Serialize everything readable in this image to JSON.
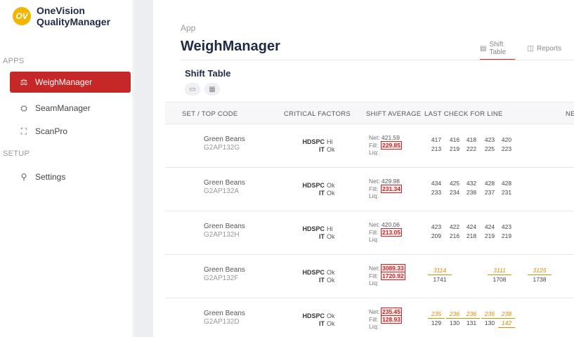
{
  "app": {
    "logo_mark": "OV",
    "logo_line1": "OneVision",
    "logo_line2": "QualityManager"
  },
  "sidebar": {
    "apps_label": "APPS",
    "setup_label": "SETUP",
    "items": [
      {
        "label": "WeighManager",
        "icon": "scale-icon",
        "glyph": "⚖",
        "active": true
      },
      {
        "label": "SeamManager",
        "icon": "seam-icon",
        "glyph": "⛭",
        "active": false
      },
      {
        "label": "ScanPro",
        "icon": "scan-icon",
        "glyph": "⛶",
        "active": false
      },
      {
        "label": "Settings",
        "icon": "user-settings-icon",
        "glyph": "⚲",
        "active": false
      }
    ]
  },
  "header": {
    "crumb": "App",
    "title": "WeighManager",
    "tabs": [
      {
        "label": "Shift Table",
        "glyph": "▤",
        "active": true
      },
      {
        "label": "Reports",
        "glyph": "◫",
        "active": false
      }
    ]
  },
  "section": {
    "title": "Shift Table",
    "tool_glyphs": [
      "▭",
      "▦"
    ]
  },
  "table": {
    "columns": [
      "SET / TOP CODE",
      "CRITICAL FACTORS",
      "SHIFT AVERAGE",
      "LAST CHECK FOR LINE",
      "NEXT"
    ],
    "avg_labels": {
      "net": "Net:",
      "fill": "Fill:",
      "liq": "Liq:"
    },
    "crit_labels": {
      "a": "HDSPC",
      "b": "IT"
    },
    "rows": [
      {
        "name": "Green Beans",
        "code": "G2AP132G",
        "hdspc": "Hi",
        "it": "Ok",
        "net": "421.59",
        "net_alert": false,
        "fill": "229.85",
        "fill_alert": true,
        "checks_top": [
          "417",
          "416",
          "418",
          "423",
          "420"
        ],
        "checks_bottom": [
          "213",
          "219",
          "222",
          "225",
          "223"
        ],
        "warn": false
      },
      {
        "name": "Green Beans",
        "code": "G2AP132A",
        "hdspc": "Ok",
        "it": "Ok",
        "net": "429.98",
        "net_alert": false,
        "fill": "231.34",
        "fill_alert": true,
        "checks_top": [
          "434",
          "425",
          "432",
          "428",
          "428"
        ],
        "checks_bottom": [
          "233",
          "234",
          "238",
          "237",
          "231"
        ],
        "warn": false
      },
      {
        "name": "Green Beans",
        "code": "G2AP132H",
        "hdspc": "Hi",
        "it": "Ok",
        "net": "420.06",
        "net_alert": false,
        "fill": "213.05",
        "fill_alert": true,
        "checks_top": [
          "423",
          "422",
          "424",
          "424",
          "423"
        ],
        "checks_bottom": [
          "209",
          "216",
          "218",
          "219",
          "219"
        ],
        "warn": false
      },
      {
        "name": "Green Beans",
        "code": "G2AP132F",
        "hdspc": "Ok",
        "it": "Ok",
        "net": "3089.33",
        "net_alert": true,
        "fill": "1720.92",
        "fill_alert": true,
        "checks_top": [
          "3114",
          "3111",
          "3125"
        ],
        "checks_bottom": [
          "1741",
          "1708",
          "1738"
        ],
        "warn": true
      },
      {
        "name": "Green Beans",
        "code": "G2AP132D",
        "hdspc": "Ok",
        "it": "Ok",
        "net": "235.45",
        "net_alert": true,
        "fill": "128.93",
        "fill_alert": true,
        "checks_top": [
          "235",
          "236",
          "236",
          "235",
          "238"
        ],
        "checks_bottom": [
          "129",
          "130",
          "131",
          "130",
          "142"
        ],
        "warn": true
      }
    ]
  },
  "colors": {
    "accent": "#c62828",
    "warning": "#e08a00",
    "logo": "#f2b500"
  }
}
